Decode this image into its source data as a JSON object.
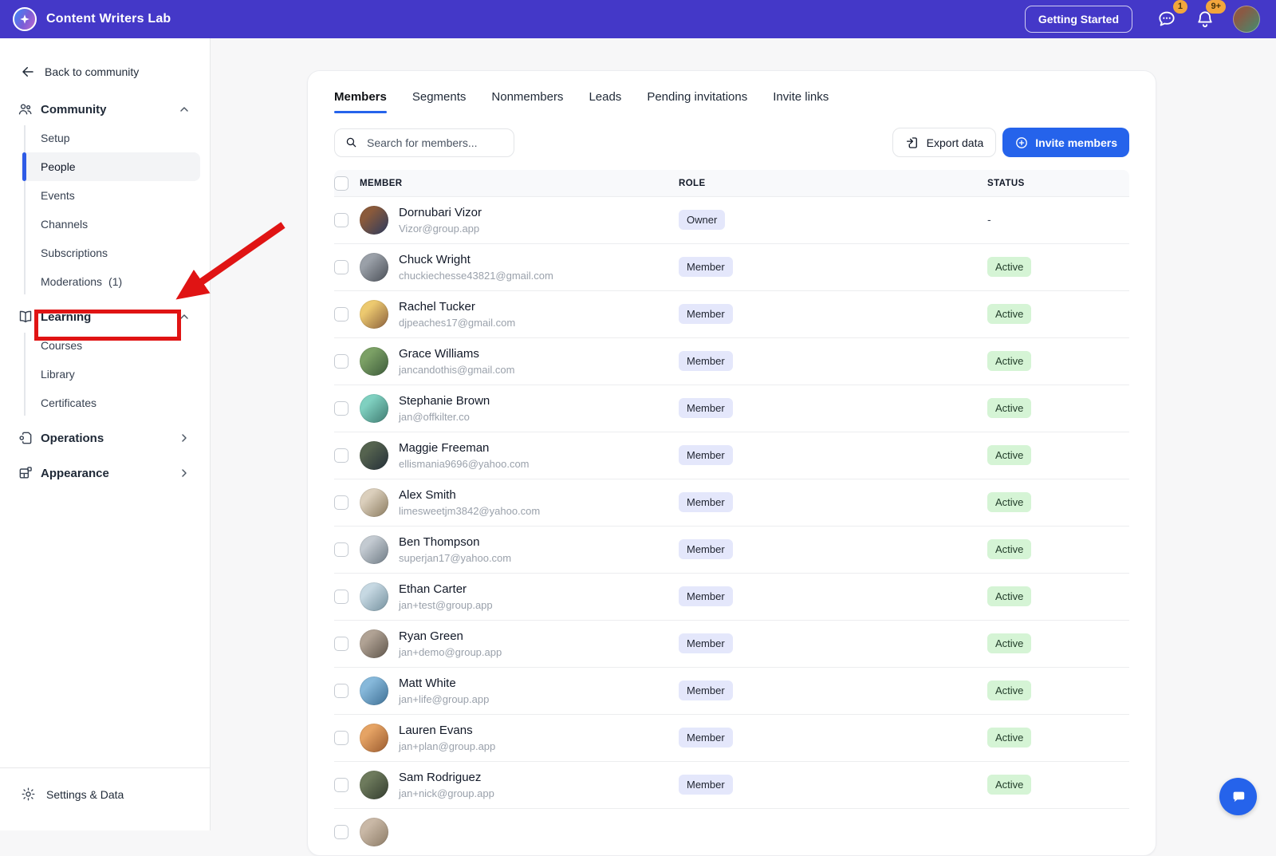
{
  "topbar": {
    "brand": "Content Writers Lab",
    "getting_started": "Getting Started",
    "chat_badge": "1",
    "notifications_badge": "9+"
  },
  "sidebar": {
    "back": "Back to community",
    "sections": [
      {
        "label": "Community",
        "chevron": "up",
        "items": [
          {
            "label": "Setup"
          },
          {
            "label": "People",
            "selected": true
          },
          {
            "label": "Events"
          },
          {
            "label": "Channels"
          },
          {
            "label": "Subscriptions"
          },
          {
            "label": "Moderations",
            "count": "(1)"
          }
        ]
      },
      {
        "label": "Learning",
        "chevron": "up",
        "annotated": true,
        "items": [
          {
            "label": "Courses"
          },
          {
            "label": "Library"
          },
          {
            "label": "Certificates"
          }
        ]
      },
      {
        "label": "Operations",
        "chevron": "right",
        "items": []
      },
      {
        "label": "Appearance",
        "chevron": "right",
        "items": []
      }
    ],
    "footer": "Settings & Data"
  },
  "main": {
    "tabs": [
      {
        "label": "Members",
        "active": true
      },
      {
        "label": "Segments"
      },
      {
        "label": "Nonmembers"
      },
      {
        "label": "Leads"
      },
      {
        "label": "Pending invitations"
      },
      {
        "label": "Invite links"
      }
    ],
    "search_placeholder": "Search for members...",
    "export_button": "Export data",
    "invite_button": "Invite members",
    "table": {
      "columns": [
        "MEMBER",
        "ROLE",
        "STATUS"
      ],
      "rows": [
        {
          "name": "Dornubari Vizor",
          "email": "Vizor@group.app",
          "role": "Owner",
          "status": "-",
          "avatar": [
            "#8a5a3b",
            "#2b3a5e"
          ]
        },
        {
          "name": "Chuck Wright",
          "email": "chuckiechesse43821@gmail.com",
          "role": "Member",
          "status": "Active",
          "avatar": [
            "#9aa0a8",
            "#4a4f57"
          ]
        },
        {
          "name": "Rachel Tucker",
          "email": "djpeaches17@gmail.com",
          "role": "Member",
          "status": "Active",
          "avatar": [
            "#ecc96f",
            "#8a5f3c"
          ]
        },
        {
          "name": "Grace Williams",
          "email": "jancandothis@gmail.com",
          "role": "Member",
          "status": "Active",
          "avatar": [
            "#7ba065",
            "#3c5a3a"
          ]
        },
        {
          "name": "Stephanie Brown",
          "email": "jan@offkilter.co",
          "role": "Member",
          "status": "Active",
          "avatar": [
            "#7fd0c0",
            "#3e7a70"
          ]
        },
        {
          "name": "Maggie Freeman",
          "email": "ellismania9696@yahoo.com",
          "role": "Member",
          "status": "Active",
          "avatar": [
            "#55634f",
            "#232e38"
          ]
        },
        {
          "name": "Alex Smith",
          "email": "limesweetjm3842@yahoo.com",
          "role": "Member",
          "status": "Active",
          "avatar": [
            "#dbcfbc",
            "#8a7a5e"
          ]
        },
        {
          "name": "Ben Thompson",
          "email": "superjan17@yahoo.com",
          "role": "Member",
          "status": "Active",
          "avatar": [
            "#c3cad1",
            "#6e7a84"
          ]
        },
        {
          "name": "Ethan Carter",
          "email": "jan+test@group.app",
          "role": "Member",
          "status": "Active",
          "avatar": [
            "#c6d8e2",
            "#74909e"
          ]
        },
        {
          "name": "Ryan Green",
          "email": "jan+demo@group.app",
          "role": "Member",
          "status": "Active",
          "avatar": [
            "#b0a294",
            "#5e544a"
          ]
        },
        {
          "name": "Matt White",
          "email": "jan+life@group.app",
          "role": "Member",
          "status": "Active",
          "avatar": [
            "#86b8da",
            "#3e6f94"
          ]
        },
        {
          "name": "Lauren Evans",
          "email": "jan+plan@group.app",
          "role": "Member",
          "status": "Active",
          "avatar": [
            "#e5a364",
            "#9a5a2e"
          ]
        },
        {
          "name": "Sam Rodriguez",
          "email": "jan+nick@group.app",
          "role": "Member",
          "status": "Active",
          "avatar": [
            "#6d7a5c",
            "#333c2e"
          ]
        },
        {
          "name": "",
          "email": "",
          "role": "",
          "status": "",
          "avatar": [
            "#c9b8a6",
            "#8c7b66"
          ],
          "partial": true
        }
      ]
    }
  },
  "colors": {
    "topbar_bg": "#4438C8",
    "accent_blue": "#2563EB",
    "annotation_red": "#E01414",
    "badge_amber": "#F2A63C",
    "role_badge_bg": "#E4E7FB",
    "status_badge_bg": "#D5F4D5",
    "selected_item_bg": "#F3F4F6"
  }
}
